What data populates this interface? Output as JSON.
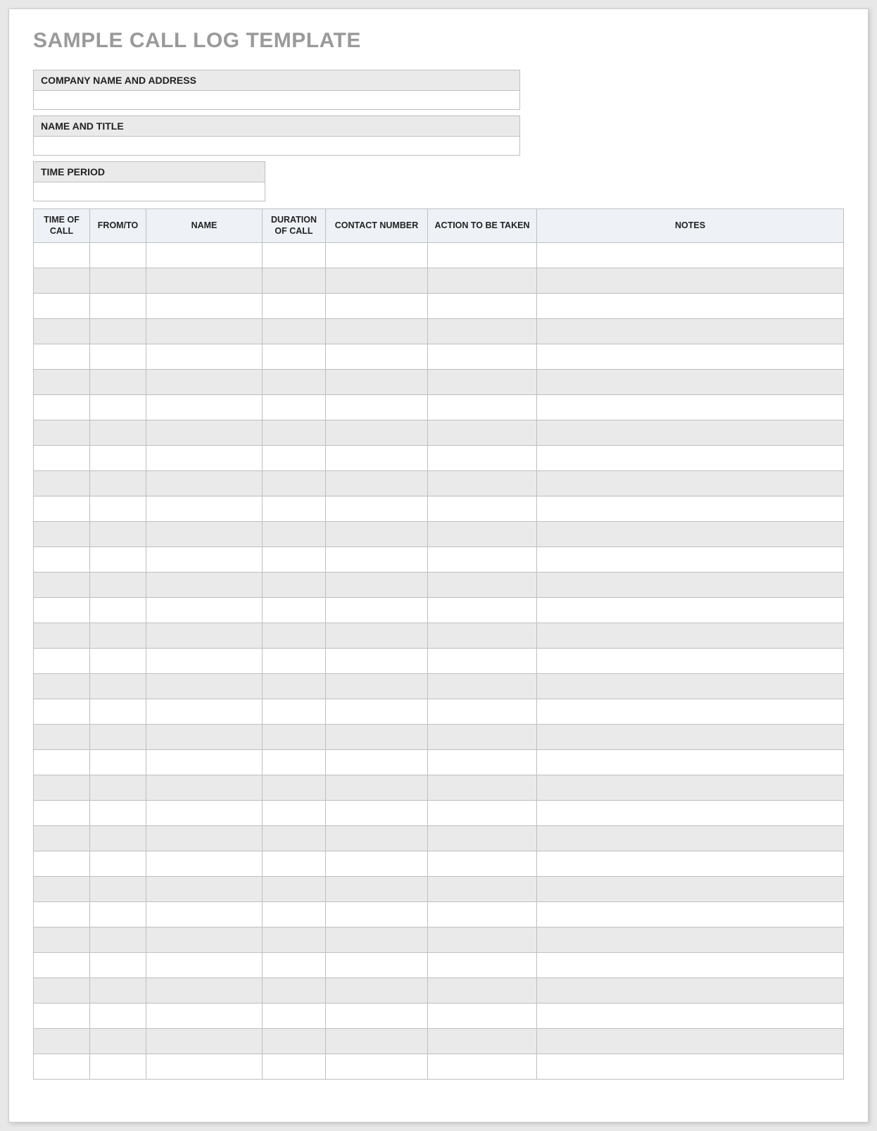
{
  "title": "SAMPLE CALL LOG TEMPLATE",
  "header_fields": [
    {
      "label": "COMPANY NAME AND ADDRESS",
      "value": "",
      "size": "wide"
    },
    {
      "label": "NAME AND TITLE",
      "value": "",
      "size": "wide"
    },
    {
      "label": "TIME PERIOD",
      "value": "",
      "size": "small"
    }
  ],
  "table": {
    "columns": [
      "TIME OF CALL",
      "FROM/TO",
      "NAME",
      "DURATION OF CALL",
      "CONTACT NUMBER",
      "ACTION TO BE TAKEN",
      "NOTES"
    ],
    "rows": [
      [
        "",
        "",
        "",
        "",
        "",
        "",
        ""
      ],
      [
        "",
        "",
        "",
        "",
        "",
        "",
        ""
      ],
      [
        "",
        "",
        "",
        "",
        "",
        "",
        ""
      ],
      [
        "",
        "",
        "",
        "",
        "",
        "",
        ""
      ],
      [
        "",
        "",
        "",
        "",
        "",
        "",
        ""
      ],
      [
        "",
        "",
        "",
        "",
        "",
        "",
        ""
      ],
      [
        "",
        "",
        "",
        "",
        "",
        "",
        ""
      ],
      [
        "",
        "",
        "",
        "",
        "",
        "",
        ""
      ],
      [
        "",
        "",
        "",
        "",
        "",
        "",
        ""
      ],
      [
        "",
        "",
        "",
        "",
        "",
        "",
        ""
      ],
      [
        "",
        "",
        "",
        "",
        "",
        "",
        ""
      ],
      [
        "",
        "",
        "",
        "",
        "",
        "",
        ""
      ],
      [
        "",
        "",
        "",
        "",
        "",
        "",
        ""
      ],
      [
        "",
        "",
        "",
        "",
        "",
        "",
        ""
      ],
      [
        "",
        "",
        "",
        "",
        "",
        "",
        ""
      ],
      [
        "",
        "",
        "",
        "",
        "",
        "",
        ""
      ],
      [
        "",
        "",
        "",
        "",
        "",
        "",
        ""
      ],
      [
        "",
        "",
        "",
        "",
        "",
        "",
        ""
      ],
      [
        "",
        "",
        "",
        "",
        "",
        "",
        ""
      ],
      [
        "",
        "",
        "",
        "",
        "",
        "",
        ""
      ],
      [
        "",
        "",
        "",
        "",
        "",
        "",
        ""
      ],
      [
        "",
        "",
        "",
        "",
        "",
        "",
        ""
      ],
      [
        "",
        "",
        "",
        "",
        "",
        "",
        ""
      ],
      [
        "",
        "",
        "",
        "",
        "",
        "",
        ""
      ],
      [
        "",
        "",
        "",
        "",
        "",
        "",
        ""
      ],
      [
        "",
        "",
        "",
        "",
        "",
        "",
        ""
      ],
      [
        "",
        "",
        "",
        "",
        "",
        "",
        ""
      ],
      [
        "",
        "",
        "",
        "",
        "",
        "",
        ""
      ],
      [
        "",
        "",
        "",
        "",
        "",
        "",
        ""
      ],
      [
        "",
        "",
        "",
        "",
        "",
        "",
        ""
      ],
      [
        "",
        "",
        "",
        "",
        "",
        "",
        ""
      ],
      [
        "",
        "",
        "",
        "",
        "",
        "",
        ""
      ],
      [
        "",
        "",
        "",
        "",
        "",
        "",
        ""
      ]
    ]
  },
  "colors": {
    "title_gray": "#9a9a9a",
    "header_blue": "#eef2f7",
    "row_gray": "#eaeaea",
    "border": "#bfbfbf"
  }
}
